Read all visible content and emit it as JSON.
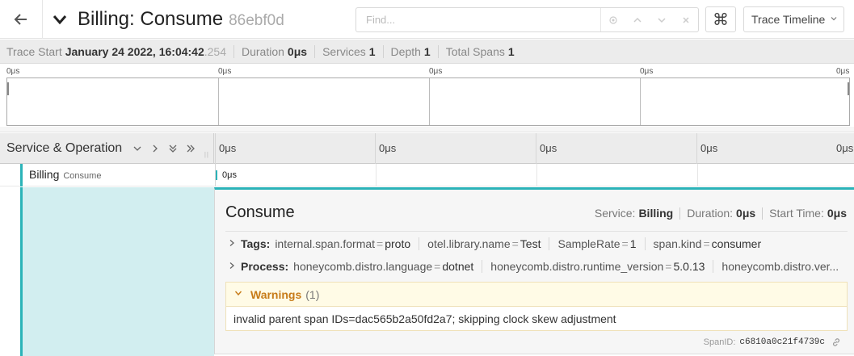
{
  "header": {
    "title": "Billing: Consume",
    "trace_id": "86ebf0d",
    "find_placeholder": "Find...",
    "find_value": "",
    "keyboard_shortcut_symbol": "⌘",
    "view_select": "Trace Timeline"
  },
  "summary": {
    "trace_start_label": "Trace Start",
    "trace_start_value": "January 24 2022, 16:04:42",
    "trace_start_ms": ".254",
    "duration_label": "Duration",
    "duration_value": "0μs",
    "services_label": "Services",
    "services_value": "1",
    "depth_label": "Depth",
    "depth_value": "1",
    "total_spans_label": "Total Spans",
    "total_spans_value": "1"
  },
  "minimap": {
    "ticks": [
      "0μs",
      "0μs",
      "0μs",
      "0μs",
      "0μs"
    ]
  },
  "timeline_header": {
    "label": "Service & Operation",
    "ticks": [
      "0μs",
      "0μs",
      "0μs",
      "0μs",
      "0μs"
    ]
  },
  "span": {
    "service": "Billing",
    "operation": "Consume",
    "duration_label": "0μs"
  },
  "detail": {
    "title": "Consume",
    "service_label": "Service:",
    "service_value": "Billing",
    "duration_label": "Duration:",
    "duration_value": "0μs",
    "start_label": "Start Time:",
    "start_value": "0μs",
    "tags_label": "Tags:",
    "tags": [
      {
        "key": "internal.span.format",
        "value": "proto"
      },
      {
        "key": "otel.library.name",
        "value": "Test"
      },
      {
        "key": "SampleRate",
        "value": "1"
      },
      {
        "key": "span.kind",
        "value": "consumer"
      }
    ],
    "process_label": "Process:",
    "process": [
      {
        "key": "honeycomb.distro.language",
        "value": "dotnet"
      },
      {
        "key": "honeycomb.distro.runtime_version",
        "value": "5.0.13"
      },
      {
        "key": "honeycomb.distro.ver...",
        "value": ""
      }
    ],
    "warnings_label": "Warnings",
    "warnings_count": "(1)",
    "warning_message": "invalid parent span IDs=dac565b2a50fd2a7; skipping clock skew adjustment",
    "span_id_label": "SpanID:",
    "span_id_value": "c6810a0c21f4739c"
  },
  "colors": {
    "service_accent": "#2bb3b8",
    "warning_text": "#c77b18",
    "detail_left_fill": "#d2eef0"
  }
}
